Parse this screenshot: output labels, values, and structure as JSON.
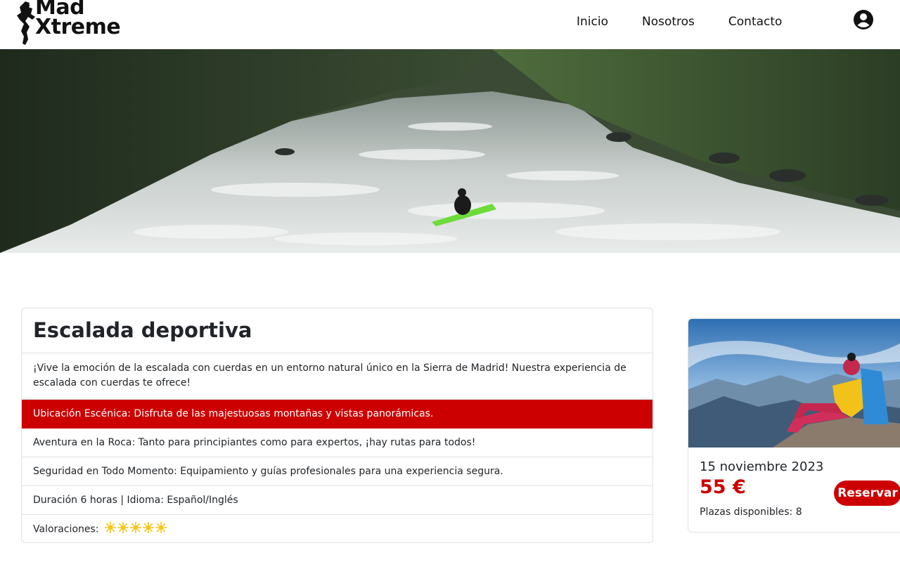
{
  "brand": {
    "line1": "Mad",
    "line2": "Xtreme"
  },
  "nav": {
    "items": [
      "Inicio",
      "Nosotros",
      "Contacto"
    ],
    "user_icon": "user-circle-icon"
  },
  "hero": {
    "image": "kayak-river-rapids"
  },
  "activity": {
    "title": "Escalada deportiva",
    "description": "¡Vive la emoción de la escalada con cuerdas en un entorno natural único en la Sierra de Madrid! Nuestra experiencia de escalada con cuerdas te ofrece!",
    "features": [
      "Ubicación Escénica: Disfruta de las majestuosas montañas y vistas panorámicas.",
      "Aventura en la Roca: Tanto para principiantes como para expertos, ¡hay rutas para todos!",
      "Seguridad en Todo Momento: Equipamiento y guías profesionales para una experiencia segura.",
      "Duración 6 horas | Idioma: Español/Inglés"
    ],
    "rating_label": "Valoraciones:",
    "rating": 5,
    "rating_icon": "sun-icon"
  },
  "booking": {
    "image": "hiker-mountain-view",
    "date": "15 noviembre 2023",
    "price": "55 €",
    "seats": "Plazas disponibles: 8",
    "reserve_label": "Reservar"
  },
  "colors": {
    "accent": "#cc0000",
    "star": "#f5c518",
    "border": "#dee2e6"
  }
}
